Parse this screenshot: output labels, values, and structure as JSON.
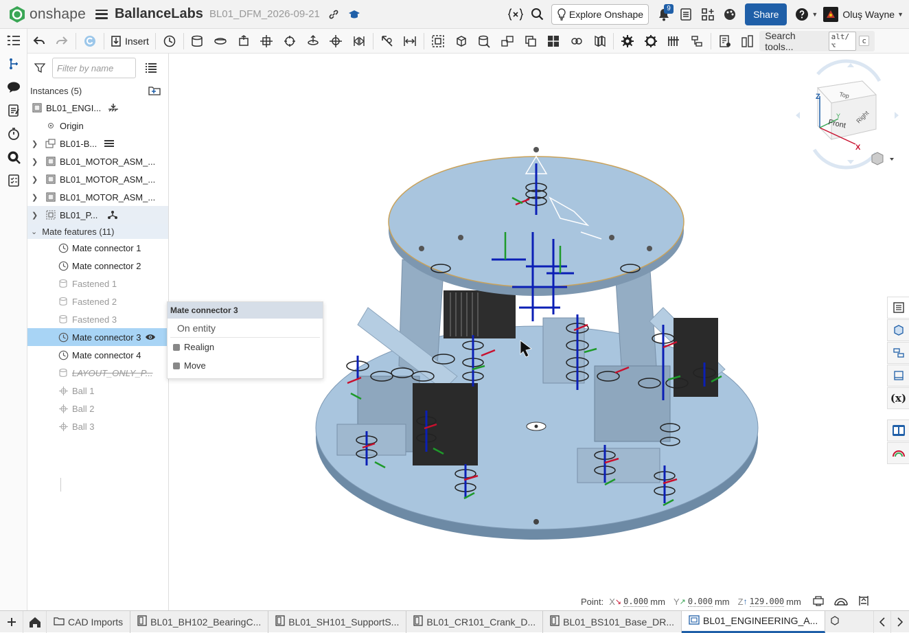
{
  "header": {
    "app_name": "onshape",
    "doc_title": "BallanceLabs",
    "workspace": "BL01_DFM_2026-09-21",
    "explore_label": "Explore Onshape",
    "notification_count": "9",
    "share_label": "Share",
    "user_name": "Oluş Wayne"
  },
  "toolbar": {
    "insert_label": "Insert",
    "search_tools_label": "Search tools...",
    "search_shortcut_1": "alt/⌥",
    "search_shortcut_2": "c"
  },
  "panel": {
    "filter_placeholder": "Filter by name",
    "instances_label": "Instances (5)",
    "instances": [
      {
        "label": "BL01_ENGI...",
        "icon": "part-studio-icon"
      },
      {
        "label": "Origin",
        "icon": "origin-icon"
      },
      {
        "label": "BL01-B...",
        "icon": "subassembly-icon"
      },
      {
        "label": "BL01_MOTOR_ASM_...",
        "icon": "assembly-icon"
      },
      {
        "label": "BL01_MOTOR_ASM_...",
        "icon": "assembly-icon"
      },
      {
        "label": "BL01_MOTOR_ASM_...",
        "icon": "assembly-icon"
      },
      {
        "label": "BL01_P...",
        "icon": "part-icon"
      }
    ],
    "mate_features_label": "Mate features (11)",
    "mates": [
      {
        "label": "Mate connector 1",
        "icon": "mate-connector-icon"
      },
      {
        "label": "Mate connector 2",
        "icon": "mate-connector-icon"
      },
      {
        "label": "Fastened 1",
        "icon": "fastened-mate-icon"
      },
      {
        "label": "Fastened 2",
        "icon": "fastened-mate-icon"
      },
      {
        "label": "Fastened 3",
        "icon": "fastened-mate-icon"
      },
      {
        "label": "Mate connector 3",
        "icon": "mate-connector-icon"
      },
      {
        "label": "Mate connector 4",
        "icon": "mate-connector-icon"
      },
      {
        "label": "LAYOUT_ONLY_P...",
        "icon": "fastened-mate-icon"
      },
      {
        "label": "Ball 1",
        "icon": "ball-mate-icon"
      },
      {
        "label": "Ball 2",
        "icon": "ball-mate-icon"
      },
      {
        "label": "Ball 3",
        "icon": "ball-mate-icon"
      }
    ]
  },
  "context_menu": {
    "title": "Mate connector 3",
    "subtitle": "On entity",
    "items": [
      "Realign",
      "Move"
    ]
  },
  "point_bar": {
    "label": "Point:",
    "x_label": "X",
    "x_value": "0.000",
    "y_label": "Y",
    "y_value": "0.000",
    "z_label": "Z",
    "z_value": "129.000",
    "unit": "mm"
  },
  "viewcube": {
    "top": "Top",
    "front": "Front",
    "right": "Right",
    "axis_x": "X",
    "axis_y": "Y",
    "axis_z": "Z"
  },
  "bottom_tabs": {
    "folder": "CAD Imports",
    "tabs": [
      "BL01_BH102_BearingC...",
      "BL01_SH101_SupportS...",
      "BL01_CR101_Crank_D...",
      "BL01_BS101_Base_DR...",
      "BL01_ENGINEERING_A..."
    ]
  }
}
